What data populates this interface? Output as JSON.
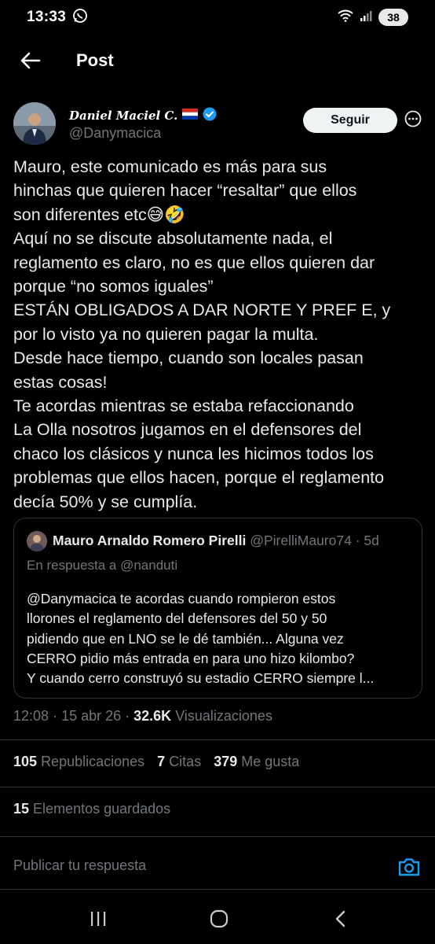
{
  "status_bar": {
    "time": "13:33",
    "battery": "38",
    "icons": [
      "whatsapp-icon",
      "wifi-icon",
      "signal-icon",
      "battery-icon"
    ]
  },
  "header": {
    "title": "Post"
  },
  "author": {
    "name": "Daniel Maciel C.",
    "handle": "@Danymacica",
    "follow_label": "Seguir",
    "verified_color": "#1d9bf0"
  },
  "tweet": {
    "lines": [
      "Mauro, este comunicado es más para sus",
      "hinchas que quieren hacer “resaltar” que ellos",
      "son diferentes etc😅🤣",
      "Aquí no se discute absolutamente nada, el",
      "reglamento es claro, no es que ellos quieren dar",
      "porque “no somos iguales”",
      "ESTÁN OBLIGADOS A DAR NORTE Y PREF E, y",
      "por lo visto ya no quieren pagar la multa.",
      "Desde hace tiempo, cuando son locales pasan",
      "estas cosas!",
      "Te acordas mientras se estaba refaccionando",
      "La Olla nosotros jugamos en el defensores del",
      "chaco los clásicos y nunca les hicimos todos los",
      "problemas que ellos hacen, porque el reglamento",
      "decía 50% y se cumplía."
    ]
  },
  "quote": {
    "name": "Mauro Arnaldo Romero Pirelli",
    "handle": "@PirelliMauro74",
    "time": "5d",
    "reply_to": "En respuesta a @nanduti",
    "lines": [
      "@Danymacica te acordas cuando rompieron estos",
      "llorones el reglamento del defensores del 50 y 50",
      "pidiendo que en LNO se le dé también... Alguna vez",
      "CERRO pidio más entrada en para uno hizo kilombo?",
      "Y cuando cerro construyó su estadio CERRO siempre l..."
    ]
  },
  "meta": {
    "time": "12:08",
    "date": "15 abr 26",
    "views": "32.6K",
    "views_label": "Visualizaciones"
  },
  "stats": {
    "reposts": "105",
    "reposts_label": "Republicaciones",
    "quotes": "7",
    "quotes_label": "Citas",
    "likes": "379",
    "likes_label": "Me gusta",
    "bookmarks": "15",
    "bookmarks_label": "Elementos guardados"
  },
  "reply": {
    "placeholder": "Publicar tu respuesta"
  },
  "colors": {
    "background": "#000000",
    "text": "#e7e9ea",
    "muted": "#71767b",
    "accent": "#1d9bf0",
    "divider": "#2f3336"
  }
}
